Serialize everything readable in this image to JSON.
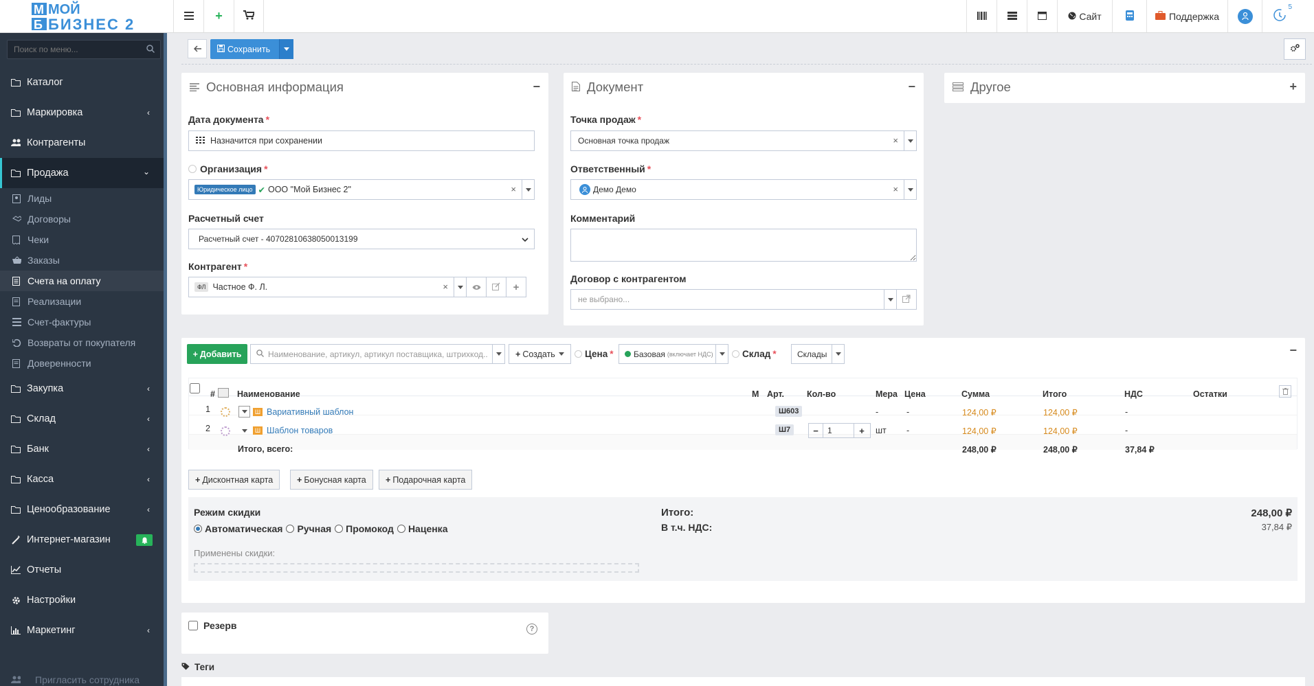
{
  "app": {
    "logo_text_top": "МОЙ",
    "logo_text_bottom": "БИЗНЕС 2"
  },
  "topbar": {
    "site_label": "Сайт",
    "support_label": "Поддержка",
    "notifications_count": "5"
  },
  "sidebar": {
    "search_placeholder": "Поиск по меню...",
    "items": [
      {
        "label": "Каталог",
        "icon": "folder-icon"
      },
      {
        "label": "Маркировка",
        "icon": "folder-icon"
      },
      {
        "label": "Контрагенты",
        "icon": "users-icon"
      },
      {
        "label": "Продажа",
        "icon": "folder-icon"
      },
      {
        "label": "Закупка",
        "icon": "folder-icon"
      },
      {
        "label": "Склад",
        "icon": "folder-icon"
      },
      {
        "label": "Банк",
        "icon": "folder-icon"
      },
      {
        "label": "Касса",
        "icon": "folder-icon"
      },
      {
        "label": "Ценообразование",
        "icon": "folder-icon"
      },
      {
        "label": "Интернет-магазин",
        "icon": "magic-icon"
      },
      {
        "label": "Отчеты",
        "icon": "chart-icon"
      },
      {
        "label": "Настройки",
        "icon": "gear-icon"
      },
      {
        "label": "Маркетинг",
        "icon": "bar-chart-icon"
      }
    ],
    "sub_items": [
      "Лиды",
      "Договоры",
      "Чеки",
      "Заказы",
      "Счета на оплату",
      "Реализации",
      "Счет-фактуры",
      "Возвраты от покупателя",
      "Доверенности"
    ],
    "invite_label": "Пригласить сотрудника"
  },
  "toolbar": {
    "save_label": "Сохранить"
  },
  "basic_info": {
    "title": "Основная информация",
    "date_label": "Дата документа",
    "date_value": "Назначится при сохранении",
    "org_label": "Организация",
    "org_tag": "Юридическое лицо",
    "org_value": "ООО \"Мой Бизнес 2\"",
    "account_label": "Расчетный счет",
    "account_value": "Расчетный счет - 40702810638050013199",
    "contractor_label": "Контрагент",
    "contractor_tag": "ФЛ",
    "contractor_value": "Частное Ф. Л."
  },
  "document": {
    "title": "Документ",
    "pos_label": "Точка продаж",
    "pos_value": "Основная точка продаж",
    "resp_label": "Ответственный",
    "resp_value": "Демо Демо",
    "comment_label": "Комментарий",
    "contract_label": "Договор с контрагентом",
    "contract_placeholder": "не выбрано..."
  },
  "other": {
    "title": "Другое"
  },
  "products": {
    "add_label": "Добавить",
    "search_placeholder": "Наименование, артикул, артикул поставщика, штрихкод...",
    "create_label": "Создать",
    "price_label": "Цена",
    "price_value": "Базовая",
    "price_note": "(включает НДС)",
    "warehouse_label": "Склад",
    "warehouse_value": "Склады",
    "columns": [
      "#",
      "Наименование",
      "М",
      "Арт.",
      "Кол-во",
      "Мера",
      "Цена",
      "Сумма",
      "Итого",
      "НДС",
      "Остатки"
    ],
    "rows": [
      {
        "n": "1",
        "name": "Вариативный шаблон",
        "art": "Ш603",
        "qty": "",
        "unit": "-",
        "price": "-",
        "sum": "124,00 ₽",
        "total": "124,00 ₽",
        "vat": "-"
      },
      {
        "n": "2",
        "name": "Шаблон товаров",
        "art": "Ш7",
        "qty": "1",
        "unit": "шт",
        "price": "-",
        "sum": "124,00 ₽",
        "total": "124,00 ₽",
        "vat": "-"
      }
    ],
    "totals_label": "Итого, всего:",
    "totals_sum": "248,00 ₽",
    "totals_total": "248,00 ₽",
    "totals_vat": "37,84 ₽"
  },
  "cards": {
    "discount": "Дисконтная карта",
    "bonus": "Бонусная карта",
    "gift": "Подарочная карта"
  },
  "discount": {
    "mode_label": "Режим скидки",
    "options": [
      "Автоматическая",
      "Ручная",
      "Промокод",
      "Наценка"
    ],
    "applied_label": "Применены скидки:",
    "total_label": "Итого:",
    "total_value": "248,00 ₽",
    "vat_label": "В т.ч. НДС:",
    "vat_value": "37,84 ₽"
  },
  "reserve": {
    "label": "Резерв"
  },
  "tags": {
    "label": "Теги"
  }
}
